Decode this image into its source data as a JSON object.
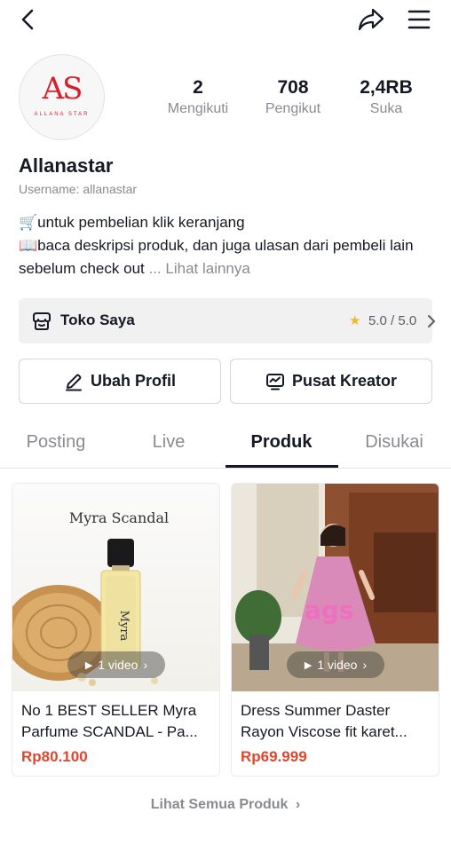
{
  "profile": {
    "name": "Allanastar",
    "username": "Username: allanastar",
    "avatar_monogram": "AS",
    "avatar_brand": "ALLANA STAR"
  },
  "stats": [
    {
      "value": "2",
      "label": "Mengikuti"
    },
    {
      "value": "708",
      "label": "Pengikut"
    },
    {
      "value": "2,4RB",
      "label": "Suka"
    }
  ],
  "bio": {
    "line1": "🛒untuk pembelian klik keranjang",
    "line2": "📖baca deskripsi produk, dan juga ulasan dari pembeli lain sebelum check out",
    "more": "... Lihat lainnya"
  },
  "shop": {
    "label": "Toko Saya",
    "rating": "5.0 / 5.0"
  },
  "buttons": {
    "edit_profile": "Ubah Profil",
    "creator_center": "Pusat Kreator"
  },
  "tabs": [
    "Posting",
    "Live",
    "Produk",
    "Disukai"
  ],
  "active_tab": "Produk",
  "products": [
    {
      "image_caption": "Myra Scandal",
      "video_label": "1 video",
      "title_line1": "No 1 BEST SELLER Myra",
      "title_line2": "Parfume SCANDAL - Pa...",
      "price": "Rp80.100"
    },
    {
      "video_label": "1 video",
      "title_line1": "Dress Summer Daster",
      "title_line2": "Rayon Viscose fit karet...",
      "price": "Rp69.999"
    }
  ],
  "see_all": "Lihat Semua Produk",
  "colors": {
    "price": "#e0462e",
    "star": "#f7b81f",
    "brand_red": "#d91f2a"
  }
}
